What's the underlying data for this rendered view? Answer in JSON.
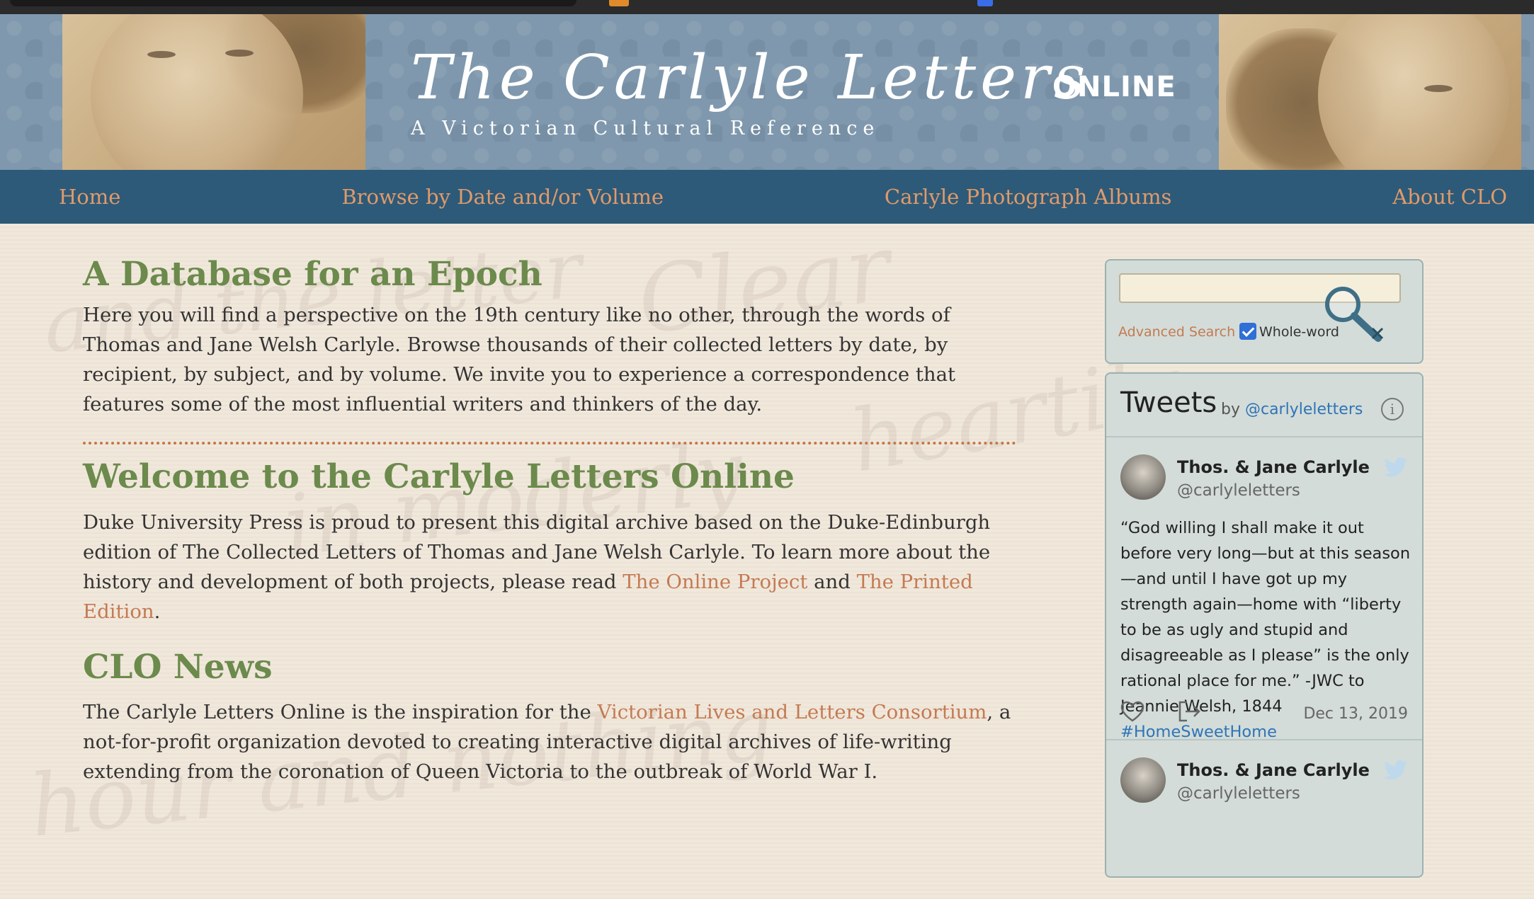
{
  "banner": {
    "title": "The Carlyle Letters",
    "online": "ONLINE",
    "subtitle": "A Victorian Cultural Reference"
  },
  "nav": {
    "items": [
      {
        "label": "Home"
      },
      {
        "label": "Browse by Date and/or Volume"
      },
      {
        "label": "Carlyle Photograph Albums"
      },
      {
        "label": "About CLO"
      }
    ]
  },
  "main": {
    "section1": {
      "heading": "A Database for an Epoch",
      "body": "Here you will find a perspective on the 19th century like no other, through the words of Thomas and Jane Welsh Carlyle. Browse thousands of their collected letters by date, by recipient, by subject, and by volume. We invite you to experience a correspondence that features some of the most influential writers and thinkers of the day."
    },
    "section2": {
      "heading": "Welcome to the Carlyle Letters Online",
      "body_before": "Duke University Press is proud to present this digital archive based on the Duke-Edinburgh edition of The Collected Letters of Thomas and Jane Welsh Carlyle. To learn more about the history and development of both projects, please read ",
      "link1": "The Online Project",
      "body_mid": " and ",
      "link2": "The Printed Edition",
      "body_after": "."
    },
    "section3": {
      "heading": "CLO News",
      "body_before": "The Carlyle Letters Online is the inspiration for the ",
      "link": "Victorian Lives and Letters Consortium",
      "body_after": ", a not-for-profit organization devoted to creating interactive digital archives of life-writing extending from the coronation of Queen Victoria to the outbreak of World War I."
    }
  },
  "search": {
    "value": "",
    "advanced_label": "Advanced Search",
    "whole_word_label": "Whole-word",
    "whole_word_checked": true
  },
  "tweets": {
    "title": "Tweets",
    "by": "by",
    "handle": "@carlyleletters",
    "items": [
      {
        "name": "Thos. & Jane Carlyle",
        "handle": "@carlyleletters",
        "text": "“God willing I shall make it out before very long—but at this season—and until I have got up my strength again—home with “liberty to be as ugly and stupid and disagreeable as I please” is the only rational place for me.” -JWC to Jeannie Welsh, 1844",
        "hashtag": "#HomeSweetHome",
        "date": "Dec 13, 2019"
      },
      {
        "name": "Thos. & Jane Carlyle",
        "handle": "@carlyleletters"
      }
    ]
  },
  "colors": {
    "nav_bg": "#2d5a79",
    "nav_link": "#e09a6a",
    "heading": "#6b8a4c",
    "link": "#c47a52",
    "twitter_link": "#2f74b8"
  }
}
